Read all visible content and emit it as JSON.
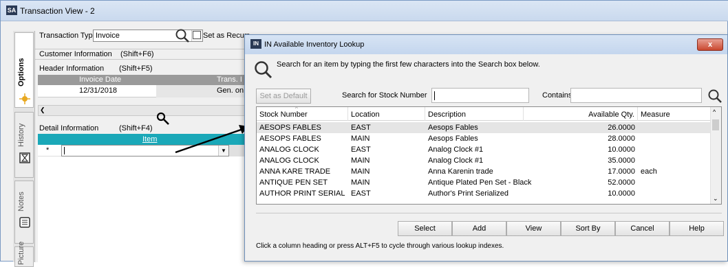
{
  "main_window": {
    "app_badge": "SA",
    "title": "Transaction View - 2",
    "transaction_type_label": "Transaction Type",
    "transaction_type_value": "Invoice",
    "recurring_label": "Set as Recurr",
    "customer_info_label": "Customer Information",
    "customer_info_shortcut": "(Shift+F6)",
    "header_info_label": "Header Information",
    "header_info_shortcut": "(Shift+F5)",
    "header_columns": [
      "Invoice Date",
      "Trans. I"
    ],
    "header_values": [
      "12/31/2018",
      "Gen. on S"
    ],
    "detail_info_label": "Detail Information",
    "detail_info_shortcut": "(Shift+F4)",
    "detail_column": "Item",
    "detail_row_marker": "*"
  },
  "side_tabs": [
    "Options",
    "History",
    "Notes",
    "Picture"
  ],
  "dialog": {
    "badge": "IN",
    "title": "IN Available Inventory Lookup",
    "close_label": "x",
    "instruction": "Search for an item by typing the first few characters into the Search box below.",
    "set_default_label": "Set as Default",
    "search_label": "Search for Stock Number",
    "search_value": "",
    "contains_label": "Contains",
    "contains_value": "",
    "columns": [
      "Stock Number",
      "Location",
      "Description",
      "Available Qty.",
      "Measure"
    ],
    "rows": [
      [
        "AESOPS FABLES",
        "EAST",
        "Aesops Fables",
        "26.0000",
        ""
      ],
      [
        "AESOPS FABLES",
        "MAIN",
        "Aesops Fables",
        "28.0000",
        ""
      ],
      [
        "ANALOG CLOCK",
        "EAST",
        "Analog Clock #1",
        "10.0000",
        ""
      ],
      [
        "ANALOG CLOCK",
        "MAIN",
        "Analog Clock #1",
        "35.0000",
        ""
      ],
      [
        "ANNA KARE TRADE",
        "MAIN",
        "Anna Karenin trade",
        "17.0000",
        "each"
      ],
      [
        "ANTIQUE PEN SET",
        "MAIN",
        "Antique Plated Pen Set - Black",
        "52.0000",
        ""
      ],
      [
        "AUTHOR PRINT SERIAL",
        "EAST",
        "Author's Print Serialized",
        "10.0000",
        ""
      ]
    ],
    "buttons": [
      "Select",
      "Add",
      "View",
      "Sort By",
      "Cancel",
      "Help"
    ],
    "footer_hint": "Click a column heading or press ALT+F5 to cycle through various lookup indexes."
  },
  "colors": {
    "detail_header_teal": "#1aa8b8",
    "header_grid_gray": "#9a9a9a",
    "close_red": "#c9482f"
  },
  "icons": {
    "search": "magnifier-icon",
    "close": "close-icon"
  }
}
